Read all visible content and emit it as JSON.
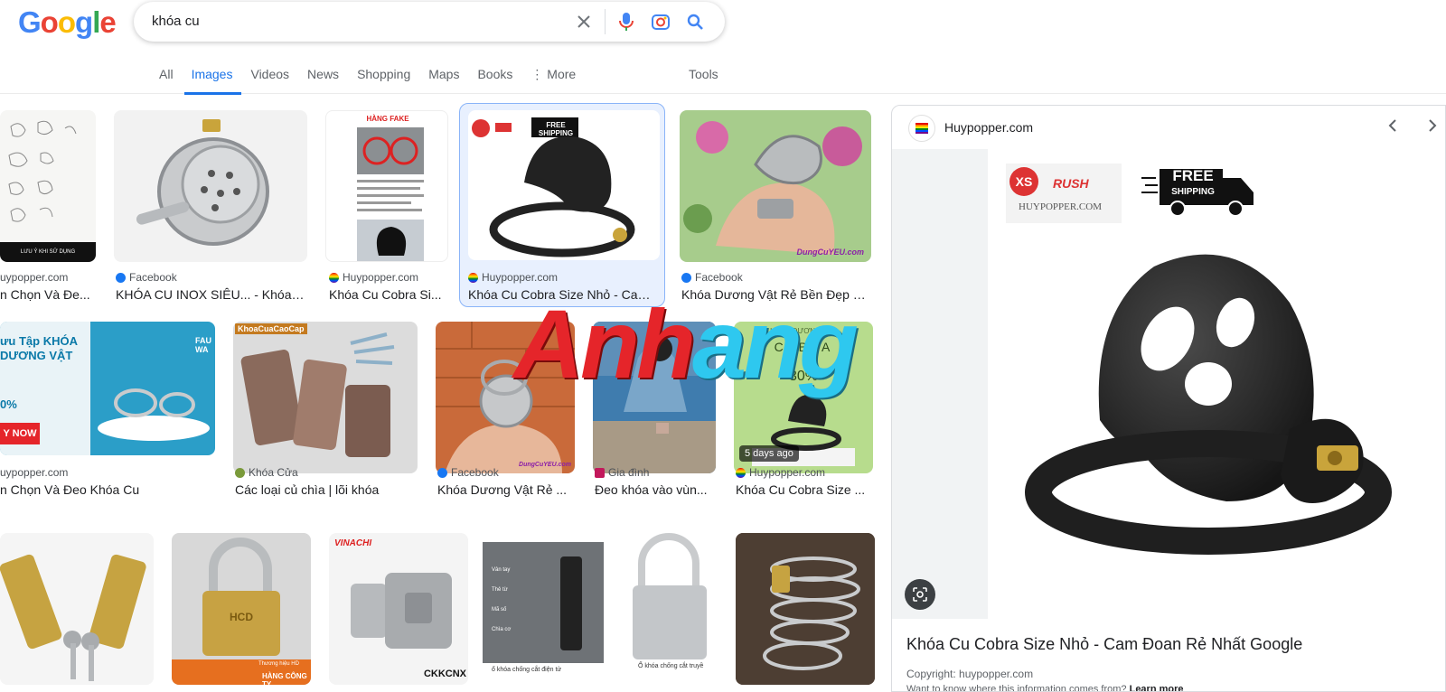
{
  "search": {
    "query": "khóa cu"
  },
  "logo": [
    "G",
    "o",
    "o",
    "g",
    "l",
    "e"
  ],
  "tabs": [
    {
      "label": "All"
    },
    {
      "label": "Images"
    },
    {
      "label": "Videos"
    },
    {
      "label": "News"
    },
    {
      "label": "Shopping"
    },
    {
      "label": "Maps"
    },
    {
      "label": "Books"
    },
    {
      "label": "⋮ More"
    }
  ],
  "tools_label": "Tools",
  "results": {
    "r1": [
      {
        "source": "uypopper.com",
        "caption": "n Chọn Và Đe..."
      },
      {
        "source": "Facebook",
        "caption": "KHÓA CU INOX SIÊU... - Khóa ..."
      },
      {
        "source": "Huypopper.com",
        "caption": "Khóa Cu Cobra Si..."
      },
      {
        "source": "Huypopper.com",
        "caption": "Khóa Cu Cobra Size Nhỏ - Cam..."
      },
      {
        "source": "Facebook",
        "caption": "Khóa Dương Vật Rẻ Bền Đẹp D..."
      }
    ],
    "r2": [
      {
        "source": "uypopper.com",
        "caption": "n Chọn Và Đeo Khóa Cu"
      },
      {
        "source": "Khóa Cửa",
        "caption": "Các loại củ chìa | lõi khóa"
      },
      {
        "source": "Facebook",
        "caption": "Khóa Dương Vật Rẻ ..."
      },
      {
        "source": "Gia đình",
        "caption": "Đeo khóa vào vùn..."
      },
      {
        "source": "Huypopper.com",
        "caption": "Khóa Cu Cobra Size ..."
      }
    ]
  },
  "thumb_text": {
    "hang_fake": "HÀNG FAKE",
    "free_shipping": "FREE SHIPPING",
    "luu_y": "LƯU Ý KHI SỬ DỤNG",
    "promo_title": "ưu Tập KHÓA DƯƠNG VẬT",
    "promo_pct": "0%",
    "promo_btn": "Y NOW",
    "promo_side": "FAU WA",
    "khoa_cua_tag": "KhoaCuaCaoCap",
    "dungcu": "DungCuYEU.com",
    "cobra_title": "COBRA",
    "cobra_sub": "KHÓA DƯƠNG VẬT",
    "cobra_pct": "30%",
    "days_ago": "5 days ago",
    "hcd": "HCD",
    "hang_cong_ty": "HÀNG CÔNG TY",
    "thuong_hieu": "Thương hiệu HD",
    "vinachi": "VINACHI",
    "ckkcnx": "CKKCNX",
    "khoa_dien_tu": "ổ khóa chống cắt điện tử",
    "khoa_truyen": "Ổ khóa chống cắt truyề",
    "menu_items": [
      "Vân tay",
      "Thẻ từ",
      "Mã số",
      "Chìa cơ"
    ]
  },
  "panel": {
    "site": "Huypopper.com",
    "title": "Khóa Cu Cobra Size Nhỏ - Cam Đoan Rẻ Nhất Google",
    "copyright": "Copyright: huypopper.com",
    "want_to_know": "Want to know where this information comes from?",
    "learn_more": "Learn more",
    "logo_xs": "XS",
    "logo_rush": "RUSH",
    "logo_site": "HUYPOPPER.COM",
    "free": "FREE",
    "shipping": "SHIPPING"
  },
  "watermark": {
    "part1": "Anh",
    "part2": "ang"
  },
  "colors": {
    "accent": "#1a73e8",
    "text": "#202124",
    "muted": "#5f6368"
  }
}
